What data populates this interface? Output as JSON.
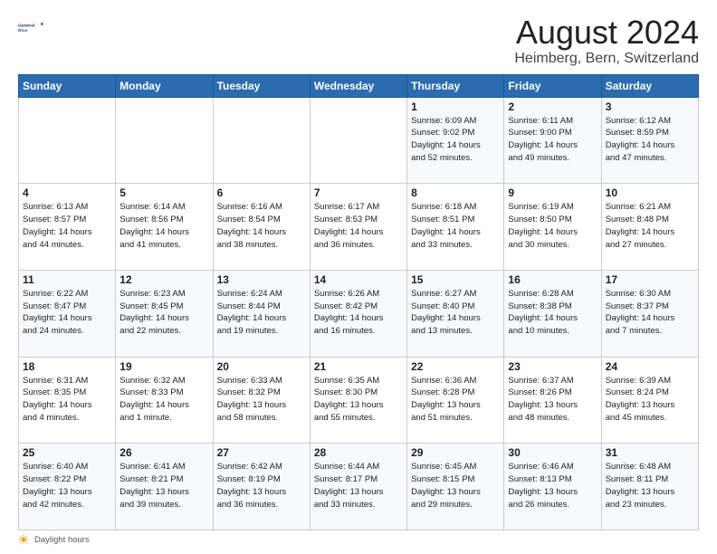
{
  "logo": {
    "line1": "General",
    "line2": "Blue"
  },
  "title": "August 2024",
  "location": "Heimberg, Bern, Switzerland",
  "days_header": [
    "Sunday",
    "Monday",
    "Tuesday",
    "Wednesday",
    "Thursday",
    "Friday",
    "Saturday"
  ],
  "weeks": [
    [
      {
        "num": "",
        "info": ""
      },
      {
        "num": "",
        "info": ""
      },
      {
        "num": "",
        "info": ""
      },
      {
        "num": "",
        "info": ""
      },
      {
        "num": "1",
        "info": "Sunrise: 6:09 AM\nSunset: 9:02 PM\nDaylight: 14 hours\nand 52 minutes."
      },
      {
        "num": "2",
        "info": "Sunrise: 6:11 AM\nSunset: 9:00 PM\nDaylight: 14 hours\nand 49 minutes."
      },
      {
        "num": "3",
        "info": "Sunrise: 6:12 AM\nSunset: 8:59 PM\nDaylight: 14 hours\nand 47 minutes."
      }
    ],
    [
      {
        "num": "4",
        "info": "Sunrise: 6:13 AM\nSunset: 8:57 PM\nDaylight: 14 hours\nand 44 minutes."
      },
      {
        "num": "5",
        "info": "Sunrise: 6:14 AM\nSunset: 8:56 PM\nDaylight: 14 hours\nand 41 minutes."
      },
      {
        "num": "6",
        "info": "Sunrise: 6:16 AM\nSunset: 8:54 PM\nDaylight: 14 hours\nand 38 minutes."
      },
      {
        "num": "7",
        "info": "Sunrise: 6:17 AM\nSunset: 8:53 PM\nDaylight: 14 hours\nand 36 minutes."
      },
      {
        "num": "8",
        "info": "Sunrise: 6:18 AM\nSunset: 8:51 PM\nDaylight: 14 hours\nand 33 minutes."
      },
      {
        "num": "9",
        "info": "Sunrise: 6:19 AM\nSunset: 8:50 PM\nDaylight: 14 hours\nand 30 minutes."
      },
      {
        "num": "10",
        "info": "Sunrise: 6:21 AM\nSunset: 8:48 PM\nDaylight: 14 hours\nand 27 minutes."
      }
    ],
    [
      {
        "num": "11",
        "info": "Sunrise: 6:22 AM\nSunset: 8:47 PM\nDaylight: 14 hours\nand 24 minutes."
      },
      {
        "num": "12",
        "info": "Sunrise: 6:23 AM\nSunset: 8:45 PM\nDaylight: 14 hours\nand 22 minutes."
      },
      {
        "num": "13",
        "info": "Sunrise: 6:24 AM\nSunset: 8:44 PM\nDaylight: 14 hours\nand 19 minutes."
      },
      {
        "num": "14",
        "info": "Sunrise: 6:26 AM\nSunset: 8:42 PM\nDaylight: 14 hours\nand 16 minutes."
      },
      {
        "num": "15",
        "info": "Sunrise: 6:27 AM\nSunset: 8:40 PM\nDaylight: 14 hours\nand 13 minutes."
      },
      {
        "num": "16",
        "info": "Sunrise: 6:28 AM\nSunset: 8:38 PM\nDaylight: 14 hours\nand 10 minutes."
      },
      {
        "num": "17",
        "info": "Sunrise: 6:30 AM\nSunset: 8:37 PM\nDaylight: 14 hours\nand 7 minutes."
      }
    ],
    [
      {
        "num": "18",
        "info": "Sunrise: 6:31 AM\nSunset: 8:35 PM\nDaylight: 14 hours\nand 4 minutes."
      },
      {
        "num": "19",
        "info": "Sunrise: 6:32 AM\nSunset: 8:33 PM\nDaylight: 14 hours\nand 1 minute."
      },
      {
        "num": "20",
        "info": "Sunrise: 6:33 AM\nSunset: 8:32 PM\nDaylight: 13 hours\nand 58 minutes."
      },
      {
        "num": "21",
        "info": "Sunrise: 6:35 AM\nSunset: 8:30 PM\nDaylight: 13 hours\nand 55 minutes."
      },
      {
        "num": "22",
        "info": "Sunrise: 6:36 AM\nSunset: 8:28 PM\nDaylight: 13 hours\nand 51 minutes."
      },
      {
        "num": "23",
        "info": "Sunrise: 6:37 AM\nSunset: 8:26 PM\nDaylight: 13 hours\nand 48 minutes."
      },
      {
        "num": "24",
        "info": "Sunrise: 6:39 AM\nSunset: 8:24 PM\nDaylight: 13 hours\nand 45 minutes."
      }
    ],
    [
      {
        "num": "25",
        "info": "Sunrise: 6:40 AM\nSunset: 8:22 PM\nDaylight: 13 hours\nand 42 minutes."
      },
      {
        "num": "26",
        "info": "Sunrise: 6:41 AM\nSunset: 8:21 PM\nDaylight: 13 hours\nand 39 minutes."
      },
      {
        "num": "27",
        "info": "Sunrise: 6:42 AM\nSunset: 8:19 PM\nDaylight: 13 hours\nand 36 minutes."
      },
      {
        "num": "28",
        "info": "Sunrise: 6:44 AM\nSunset: 8:17 PM\nDaylight: 13 hours\nand 33 minutes."
      },
      {
        "num": "29",
        "info": "Sunrise: 6:45 AM\nSunset: 8:15 PM\nDaylight: 13 hours\nand 29 minutes."
      },
      {
        "num": "30",
        "info": "Sunrise: 6:46 AM\nSunset: 8:13 PM\nDaylight: 13 hours\nand 26 minutes."
      },
      {
        "num": "31",
        "info": "Sunrise: 6:48 AM\nSunset: 8:11 PM\nDaylight: 13 hours\nand 23 minutes."
      }
    ]
  ],
  "footer": {
    "daylight_label": "Daylight hours"
  }
}
